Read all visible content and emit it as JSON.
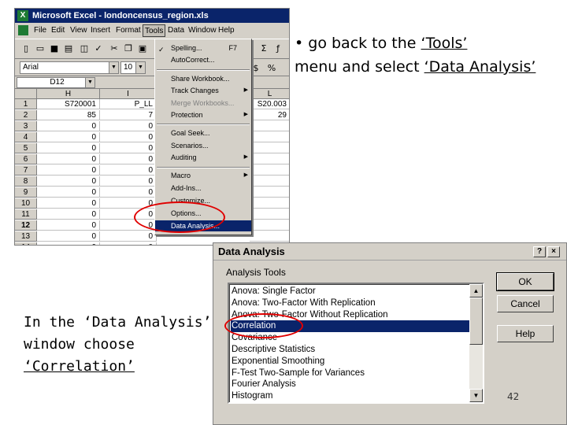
{
  "excel": {
    "title": "Microsoft Excel - londoncensus_region.xls",
    "menus": [
      "File",
      "Edit",
      "View",
      "Insert",
      "Format",
      "Tools",
      "Data",
      "Window",
      "Help"
    ],
    "font_box": "Arial",
    "size_box": "10",
    "name_box": "D12",
    "columns": [
      "H",
      "I",
      "L"
    ],
    "header_row": {
      "row": "1",
      "h": "S720001",
      "i": "P_LL",
      "l": "S20.003"
    },
    "rows": [
      {
        "row": "2",
        "h": "85",
        "i": "7",
        "l": "29"
      },
      {
        "row": "3",
        "h": "0",
        "i": "0",
        "l": ""
      },
      {
        "row": "4",
        "h": "0",
        "i": "0",
        "l": ""
      },
      {
        "row": "5",
        "h": "0",
        "i": "0",
        "l": ""
      },
      {
        "row": "6",
        "h": "0",
        "i": "0",
        "l": ""
      },
      {
        "row": "7",
        "h": "0",
        "i": "0",
        "l": ""
      },
      {
        "row": "8",
        "h": "0",
        "i": "0",
        "l": ""
      },
      {
        "row": "9",
        "h": "0",
        "i": "0",
        "l": ""
      },
      {
        "row": "10",
        "h": "0",
        "i": "0",
        "l": ""
      },
      {
        "row": "11",
        "h": "0",
        "i": "0",
        "l": ""
      },
      {
        "row": "12",
        "h": "0",
        "i": "0",
        "l": ""
      },
      {
        "row": "13",
        "h": "0",
        "i": "0",
        "l": ""
      },
      {
        "row": "14",
        "h": "0",
        "i": "0",
        "l": ""
      }
    ],
    "tools_menu": {
      "spelling": "Spelling...",
      "spelling_shortcut": "F7",
      "autocorrect": "AutoCorrect...",
      "share_workbook": "Share Workbook...",
      "track_changes": "Track Changes",
      "merge_workbooks": "Merge Workbooks...",
      "protection": "Protection",
      "goal_seek": "Goal Seek...",
      "scenarios": "Scenarios...",
      "auditing": "Auditing",
      "macro": "Macro",
      "addins": "Add-Ins...",
      "customize": "Customize...",
      "options": "Options...",
      "data_analysis": "Data Analysis..."
    }
  },
  "instructions": {
    "top_bullet": "•",
    "top_line1_pre": "go back to the ",
    "top_line1_ul": "‘Tools’",
    "top_line2_pre": "menu and select ",
    "top_line2_ul": "‘Data Analysis’",
    "bottom_line1": "In the ‘Data Analysis’",
    "bottom_line2": "window choose",
    "bottom_line3": "‘Correlation’"
  },
  "dialog": {
    "title": "Data Analysis",
    "help_btn": "?",
    "close_btn": "×",
    "tools_label": "Analysis Tools",
    "items": [
      "Anova: Single Factor",
      "Anova: Two-Factor With Replication",
      "Anova: Two-Factor Without Replication",
      "Correlation",
      "Covariance",
      "Descriptive Statistics",
      "Exponential Smoothing",
      "F-Test Two-Sample for Variances",
      "Fourier Analysis",
      "Histogram"
    ],
    "selected_index": 3,
    "ok": "OK",
    "cancel": "Cancel",
    "help": "Help"
  },
  "slide_number": "42"
}
